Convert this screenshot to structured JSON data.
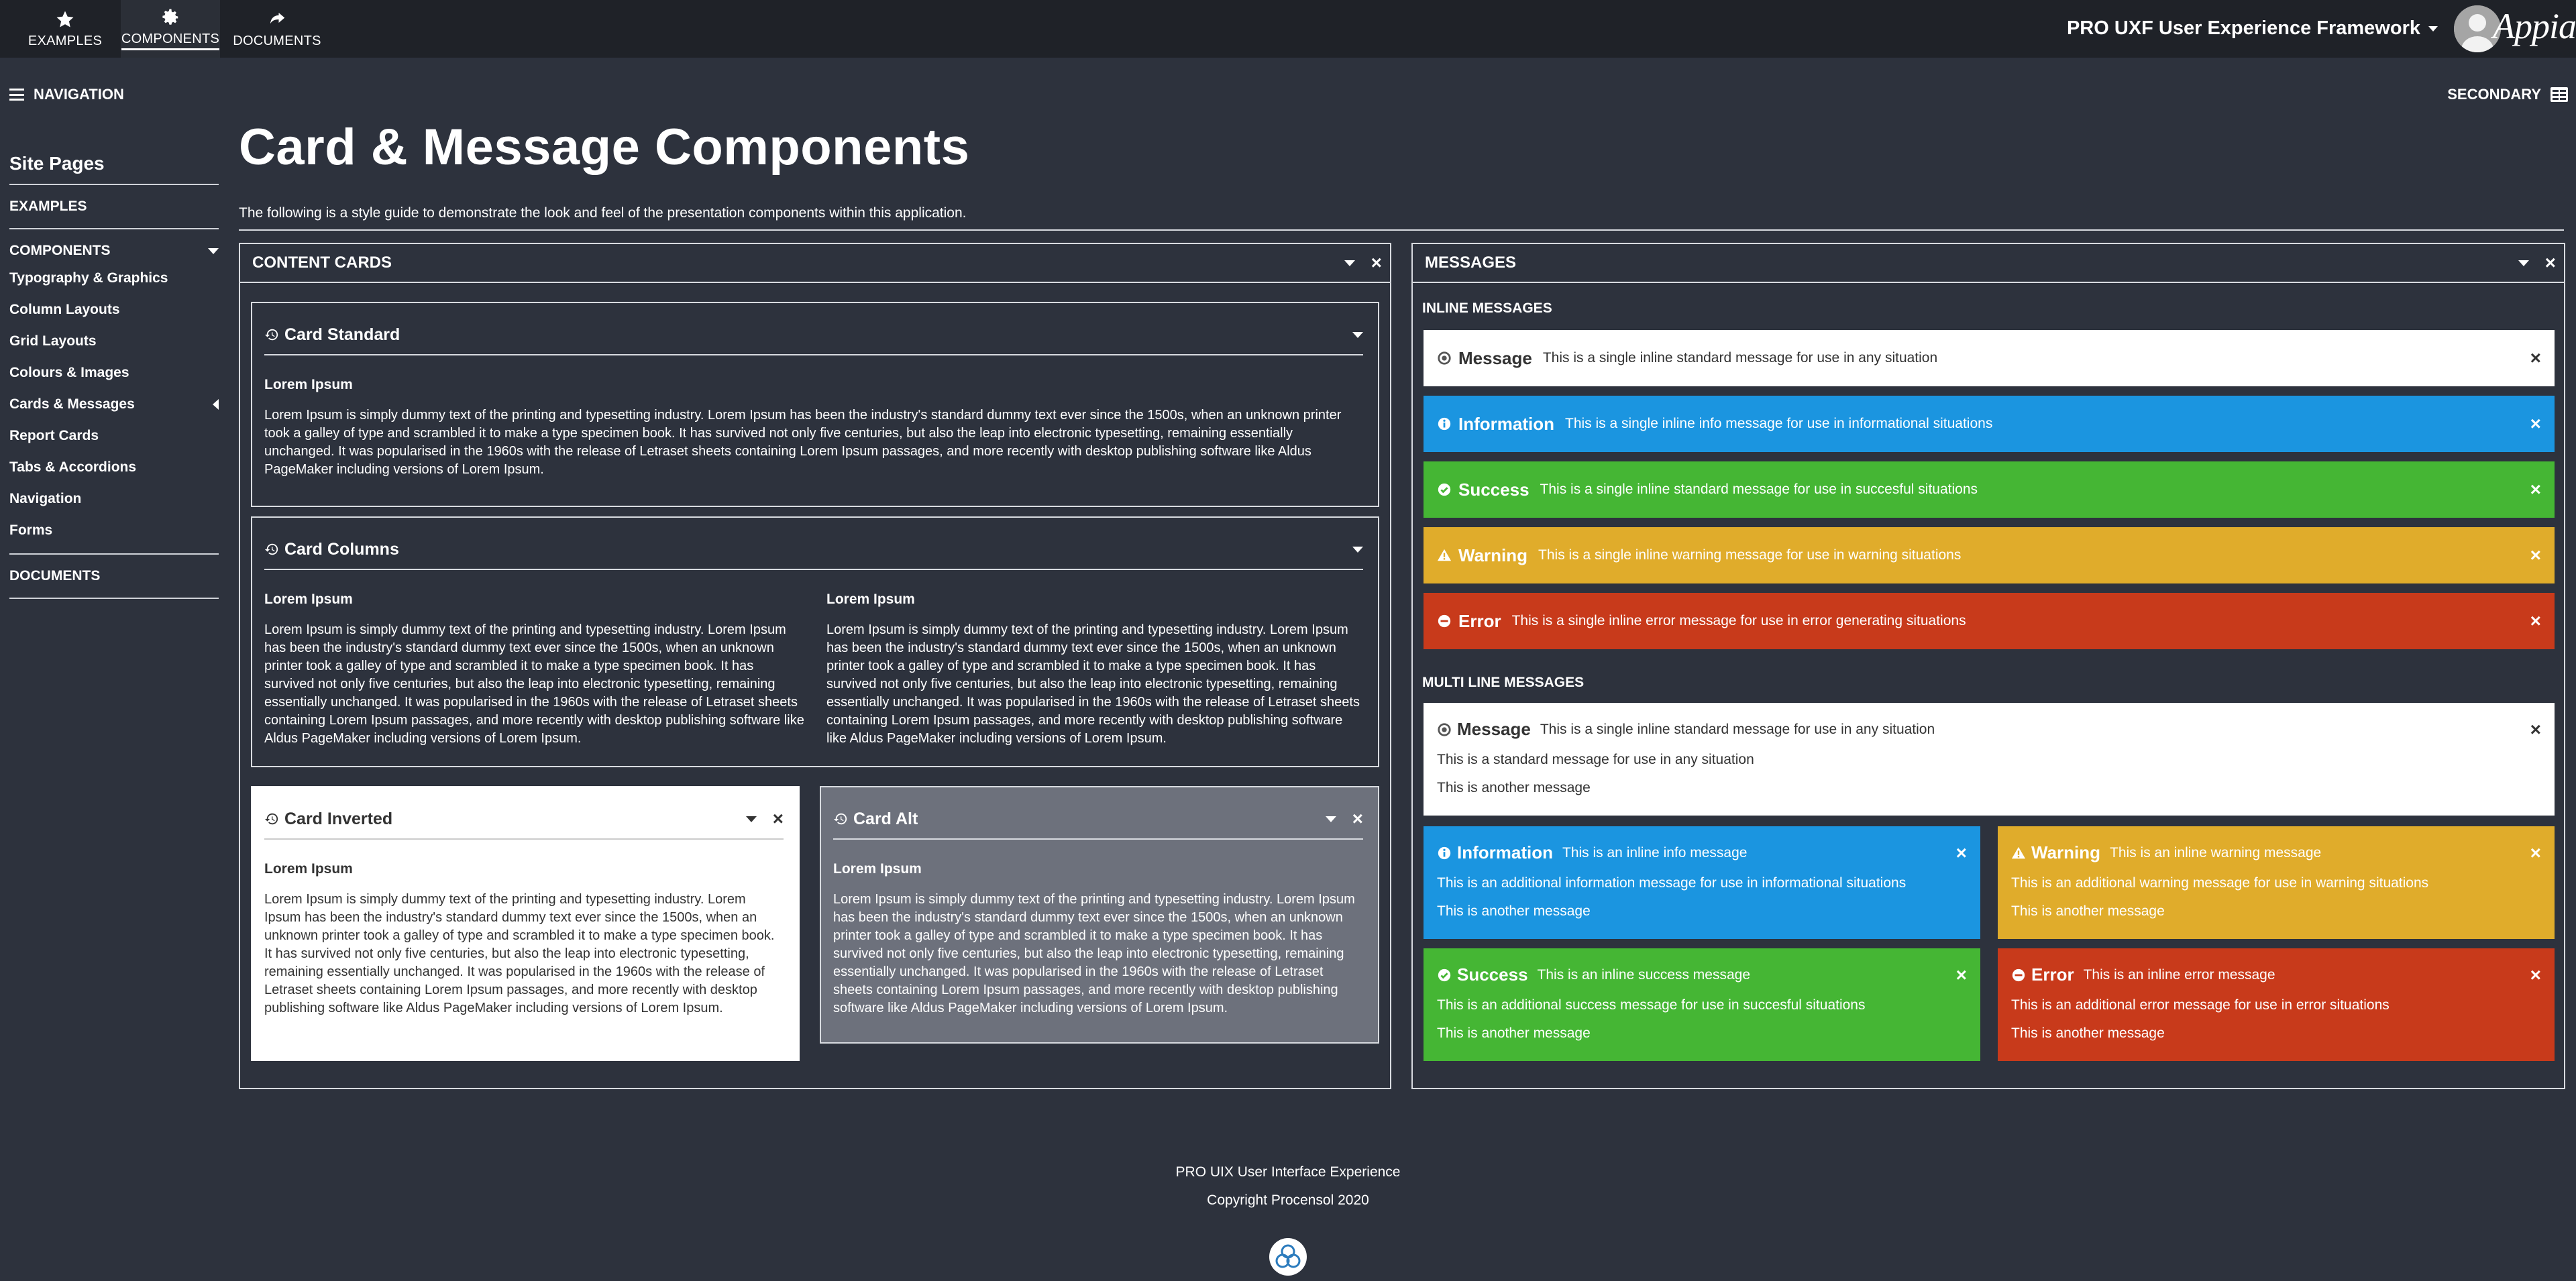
{
  "topbar": {
    "tabs": [
      {
        "label": "EXAMPLES",
        "icon": "star-icon"
      },
      {
        "label": "COMPONENTS",
        "icon": "gear-icon",
        "active": true
      },
      {
        "label": "DOCUMENTS",
        "icon": "share-icon"
      }
    ],
    "framework_title": "PRO UXF User Experience Framework",
    "logo_text": "Appia"
  },
  "toolbar": {
    "navigation_label": "NAVIGATION",
    "secondary_label": "SECONDARY"
  },
  "sidebar": {
    "heading": "Site Pages",
    "examples": "EXAMPLES",
    "components": "COMPONENTS",
    "items": [
      "Typography & Graphics",
      "Column Layouts",
      "Grid Layouts",
      "Colours & Images",
      "Cards & Messages",
      "Report Cards",
      "Tabs & Accordions",
      "Navigation",
      "Forms"
    ],
    "documents": "DOCUMENTS"
  },
  "page": {
    "title": "Card & Message Components",
    "description": "The following is a style guide to demonstrate the look and feel of the presentation components within this application."
  },
  "content_cards": {
    "title": "CONTENT CARDS",
    "subheading": "Lorem Ipsum",
    "lorem": "Lorem Ipsum is simply dummy text of the printing and typesetting industry. Lorem Ipsum has been the industry's standard dummy text ever since the 1500s, when an unknown printer took a galley of type and scrambled it to make a type specimen book. It has survived not only five centuries, but also the leap into electronic typesetting, remaining essentially unchanged. It was popularised in the 1960s with the release of Letraset sheets containing Lorem Ipsum passages, and more recently with desktop publishing software like Aldus PageMaker including versions of Lorem Ipsum.",
    "card_standard": "Card Standard",
    "card_columns": "Card Columns",
    "card_inverted": "Card Inverted",
    "card_alt": "Card Alt"
  },
  "messages": {
    "title": "MESSAGES",
    "inline_heading": "INLINE MESSAGES",
    "multiline_heading": "MULTI LINE MESSAGES",
    "inline": [
      {
        "type": "white",
        "title": "Message",
        "text": "This is a single inline standard message for use in any situation"
      },
      {
        "type": "info",
        "title": "Information",
        "text": "This is a single inline info message for use in informational situations"
      },
      {
        "type": "success",
        "title": "Success",
        "text": "This is a single inline standard message for use in succesful situations"
      },
      {
        "type": "warning",
        "title": "Warning",
        "text": "This is a single inline warning message for use in warning situations"
      },
      {
        "type": "error",
        "title": "Error",
        "text": "This is a single inline error message for use in error generating situations"
      }
    ],
    "multiline": {
      "standard": {
        "title": "Message",
        "text": "This is a single inline standard message for use in any situation",
        "line1": "This is a standard message for use in any situation",
        "line2": "This is another message"
      },
      "info": {
        "title": "Information",
        "text": "This is an inline info message",
        "line1": "This is an additional information message for use in informational situations",
        "line2": "This is another message"
      },
      "warning": {
        "title": "Warning",
        "text": "This is an inline warning message",
        "line1": "This is an additional warning message for use in warning situations",
        "line2": "This is another message"
      },
      "success": {
        "title": "Success",
        "text": "This is an inline success message",
        "line1": "This is an additional success message for use in succesful situations",
        "line2": "This is another message"
      },
      "error": {
        "title": "Error",
        "text": "This is an inline error message",
        "line1": "This is an additional error message for use in error situations",
        "line2": "This is another message"
      }
    }
  },
  "footer": {
    "line1": "PRO UIX User Interface Experience",
    "line2": "Copyright Procensol 2020"
  },
  "colors": {
    "background": "#2d323d",
    "topbar": "#1f2228",
    "info": "#1b95e0",
    "success": "#45b634",
    "warning": "#e0ac2b",
    "error": "#c83a1b",
    "card_alt": "#6d717c"
  }
}
